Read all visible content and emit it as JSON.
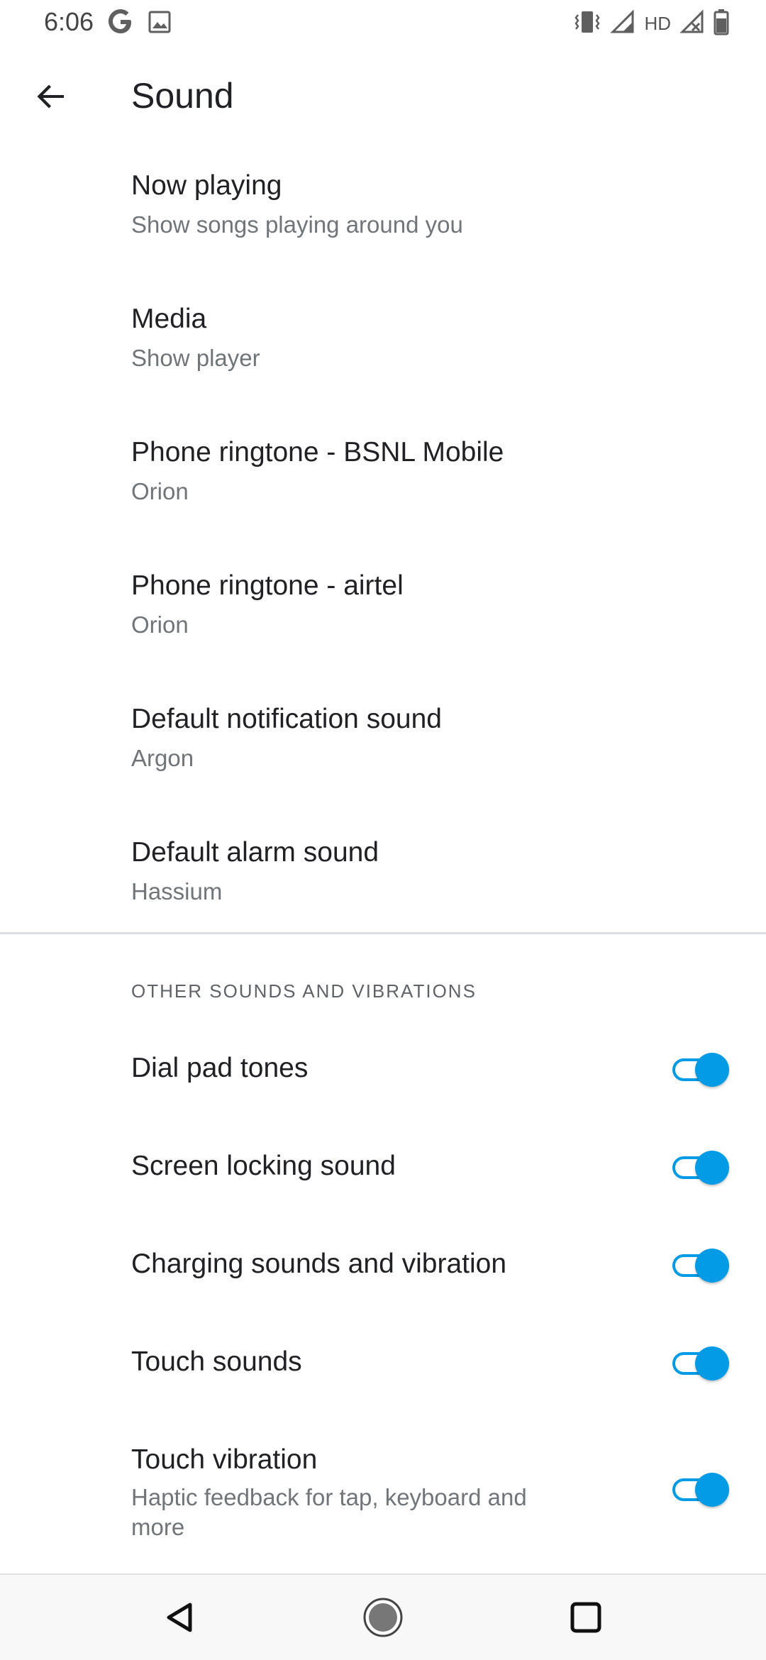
{
  "status_bar": {
    "time": "6:06",
    "hd_label": "HD",
    "icons": [
      "google-g-icon",
      "image-notification-icon",
      "vibrate-icon",
      "signal-icon",
      "signal-no-data-icon",
      "battery-icon"
    ]
  },
  "app_bar": {
    "title": "Sound",
    "back_icon": "arrow-back-icon"
  },
  "preferences": [
    {
      "title": "Now playing",
      "summary": "Show songs playing around you"
    },
    {
      "title": "Media",
      "summary": "Show player"
    },
    {
      "title": "Phone ringtone - BSNL Mobile",
      "summary": "Orion"
    },
    {
      "title": "Phone ringtone - airtel",
      "summary": "Orion"
    },
    {
      "title": "Default notification sound",
      "summary": "Argon"
    },
    {
      "title": "Default alarm sound",
      "summary": "Hassium"
    }
  ],
  "other_section": {
    "header": "OTHER SOUNDS AND VIBRATIONS",
    "toggles": [
      {
        "title": "Dial pad tones",
        "on": true
      },
      {
        "title": "Screen locking sound",
        "on": true
      },
      {
        "title": "Charging sounds and vibration",
        "on": true
      },
      {
        "title": "Touch sounds",
        "on": true
      },
      {
        "title": "Touch vibration",
        "summary_line1": "Haptic feedback for tap, keyboard and",
        "summary_line2": "more",
        "on": true
      }
    ]
  },
  "nav_bar": {
    "icons": [
      "nav-back-icon",
      "nav-home-icon",
      "nav-recents-icon"
    ]
  },
  "colors": {
    "accent": "#039be5",
    "text_primary": "#202124",
    "text_secondary": "#70757a",
    "divider": "#dadce0"
  }
}
